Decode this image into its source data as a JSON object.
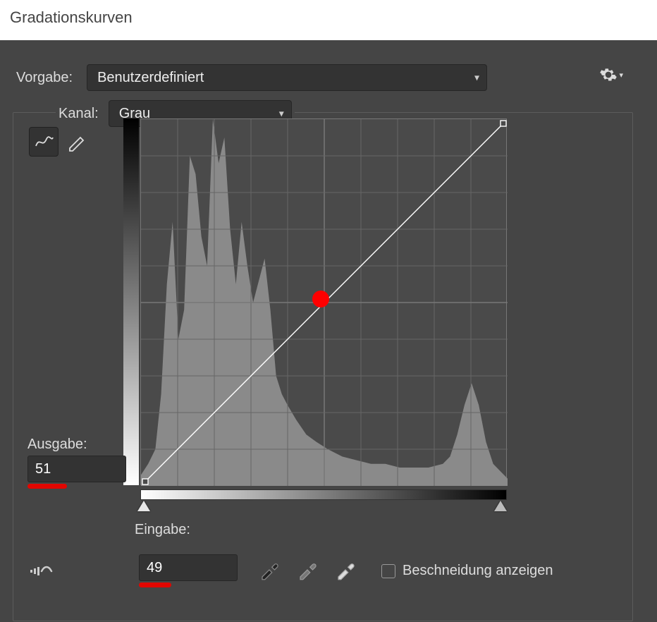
{
  "title": "Gradationskurven",
  "preset": {
    "label": "Vorgabe:",
    "value": "Benutzerdefiniert"
  },
  "channel": {
    "label": "Kanal:",
    "value": "Grau"
  },
  "output": {
    "label": "Ausgabe:",
    "value": "51"
  },
  "input": {
    "label": "Eingabe:",
    "value": "49"
  },
  "clipping": {
    "label": "Beschneidung anzeigen",
    "checked": false
  },
  "icons": {
    "curve_tool": "curve-tool",
    "pencil_tool": "pencil-tool",
    "gear": "settings",
    "auto": "auto",
    "black_picker": "black-point-eyedropper",
    "gray_picker": "gray-point-eyedropper",
    "white_picker": "white-point-eyedropper"
  },
  "curve_point": {
    "input": 49,
    "output": 51
  },
  "sliders": {
    "black": 0,
    "white": 100
  },
  "chart_data": {
    "type": "area",
    "title": "",
    "xlabel": "",
    "ylabel": "",
    "xlim": [
      0,
      255
    ],
    "ylim": [
      0,
      100
    ],
    "series": [
      {
        "name": "Histogramm",
        "x": [
          0,
          5,
          10,
          14,
          18,
          22,
          26,
          30,
          34,
          38,
          42,
          46,
          50,
          54,
          58,
          62,
          66,
          70,
          74,
          78,
          82,
          86,
          90,
          94,
          98,
          102,
          108,
          115,
          122,
          130,
          140,
          150,
          160,
          170,
          180,
          190,
          200,
          210,
          215,
          220,
          225,
          230,
          235,
          240,
          245,
          250,
          255
        ],
        "values": [
          3,
          6,
          10,
          25,
          55,
          72,
          40,
          48,
          90,
          85,
          68,
          60,
          100,
          88,
          95,
          70,
          55,
          72,
          60,
          50,
          56,
          62,
          48,
          30,
          25,
          22,
          18,
          14,
          12,
          10,
          8,
          7,
          6,
          6,
          5,
          5,
          5,
          6,
          8,
          14,
          22,
          28,
          22,
          12,
          6,
          4,
          2
        ]
      }
    ],
    "curve_points": [
      {
        "in": 0,
        "out": 0
      },
      {
        "in": 125,
        "out": 130
      },
      {
        "in": 255,
        "out": 255
      }
    ]
  }
}
